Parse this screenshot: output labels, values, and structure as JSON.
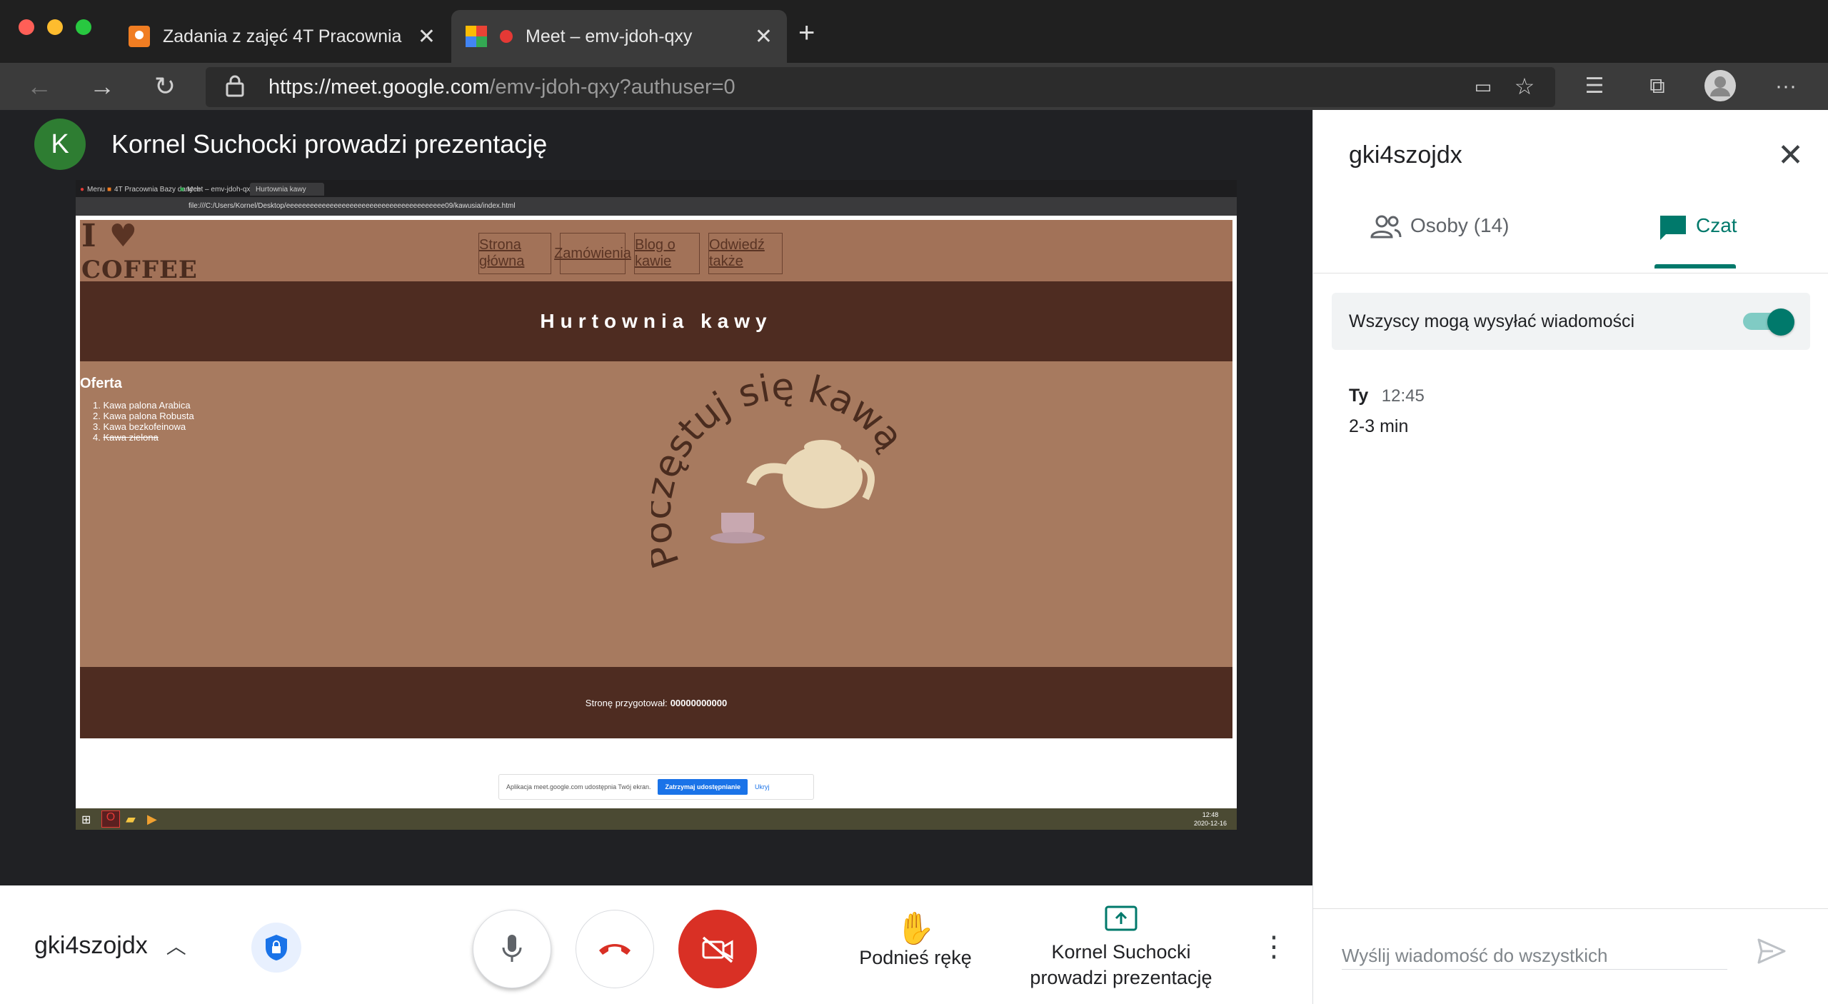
{
  "browser": {
    "tabs": [
      {
        "label": "Zadania z zajęć 4T Pracownia",
        "icon": "google-classroom-icon"
      },
      {
        "label": "Meet – emv-jdoh-qxy",
        "icon": "google-meet-icon",
        "recording": true
      }
    ],
    "url_host": "https://meet.google.com",
    "url_path": "/emv-jdoh-qxy?authuser=0"
  },
  "presenter": {
    "avatar_letter": "K",
    "avatar_color": "#2e7d32",
    "text": "Kornel Suchocki prowadzi prezentację"
  },
  "shared_screen": {
    "opera_tabs": [
      "Menu",
      "4T Pracownia Bazy danych",
      "Meet – emv-jdoh-qxy",
      "Hurtownia kawy"
    ],
    "opera_url": "file:///C:/Users/Kornel/Desktop/eeeeeeeeeeeeeeeeeeeeeeeeeeeeeeeeeeeeeeee09/kawusia/index.html",
    "site": {
      "logo_top": "I",
      "logo_bottom": "COFFEE",
      "nav": [
        "Strona główna",
        "Zamówienia",
        "Blog o kawie",
        "Odwiedź także"
      ],
      "banner": "Hurtownia kawy",
      "oferta_title": "Oferta",
      "oferta_items": [
        "Kawa palona Arabica",
        "Kawa palona Robusta",
        "Kawa bezkofeinowa",
        "Kawa zielona"
      ],
      "arc_text": "Poczęstuj się kawą",
      "footer_label": "Stronę przygotował:",
      "footer_author": "00000000000"
    },
    "share_notice": {
      "text": "Aplikacja meet.google.com udostępnia Twój ekran.",
      "stop_label": "Zatrzymaj udostępnianie",
      "hide_label": "Ukryj"
    },
    "clock_time": "12:48",
    "clock_date": "2020-12-16"
  },
  "controls": {
    "meeting_code": "gki4szojdx",
    "raise_hand_label": "Podnieś rękę",
    "present_line1": "Kornel Suchocki",
    "present_line2": "prowadzi prezentację",
    "hangup_color": "#d93025"
  },
  "panel": {
    "title": "gki4szojdx",
    "tab_people": "Osoby (14)",
    "tab_chat": "Czat",
    "toggle_label": "Wszyscy mogą wysyłać wiadomości",
    "toggle_on": true,
    "message": {
      "sender": "Ty",
      "time": "12:45",
      "text": "2-3 min"
    },
    "input_placeholder": "Wyślij wiadomość do wszystkich",
    "accent": "#00796b"
  }
}
